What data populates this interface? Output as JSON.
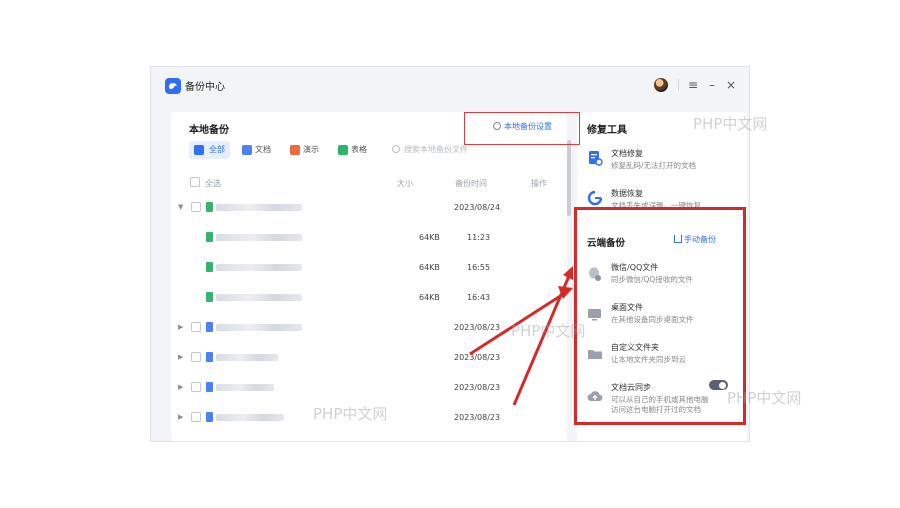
{
  "window": {
    "title": "备份中心",
    "controls": {
      "menu": "≡",
      "minimize": "–",
      "close": "×"
    }
  },
  "local_backup": {
    "title": "本地备份",
    "settings_link": "本地备份设置",
    "filters": [
      {
        "label": "全部",
        "color": "#2f6ff5"
      },
      {
        "label": "文档",
        "color": "#4b83f7"
      },
      {
        "label": "演示",
        "color": "#ec6a3c"
      },
      {
        "label": "表格",
        "color": "#2fb36b"
      }
    ],
    "search_placeholder": "搜索本地备份文件",
    "table": {
      "select_all": "全选",
      "columns": {
        "size": "大小",
        "time": "备份时间",
        "action": "操作"
      },
      "rows": [
        {
          "time": "2023/08/24",
          "size": ""
        },
        {
          "time": "11:23",
          "size": "64KB"
        },
        {
          "time": "16:55",
          "size": "64KB"
        },
        {
          "time": "16:43",
          "size": "64KB"
        },
        {
          "time": "2023/08/23",
          "size": ""
        },
        {
          "time": "2023/08/23",
          "size": ""
        },
        {
          "time": "2023/08/23",
          "size": ""
        },
        {
          "time": "2023/08/23",
          "size": ""
        }
      ]
    }
  },
  "repair_tools": {
    "title": "修复工具",
    "items": [
      {
        "name": "文档修复",
        "desc": "修复乱码/无法打开的文档"
      },
      {
        "name": "数据恢复",
        "desc": "文档丢失或误删，一键恢复"
      }
    ]
  },
  "cloud_backup": {
    "title": "云端备份",
    "manual_button": "手动备份",
    "items": [
      {
        "name": "微信/QQ文件",
        "desc": "同步微信/QQ接收的文件"
      },
      {
        "name": "桌面文件",
        "desc": "在其他设备同步桌面文件"
      },
      {
        "name": "自定义文件夹",
        "desc": "让本地文件夹同步到云"
      },
      {
        "name": "文档云同步",
        "desc": "可以从自己的手机或其他电脑",
        "desc2": "访问这台电脑打开过的文档"
      }
    ]
  },
  "watermark": "PHP中文网",
  "colors": {
    "accent": "#2f6ff5",
    "highlight": "#d52a2a"
  }
}
